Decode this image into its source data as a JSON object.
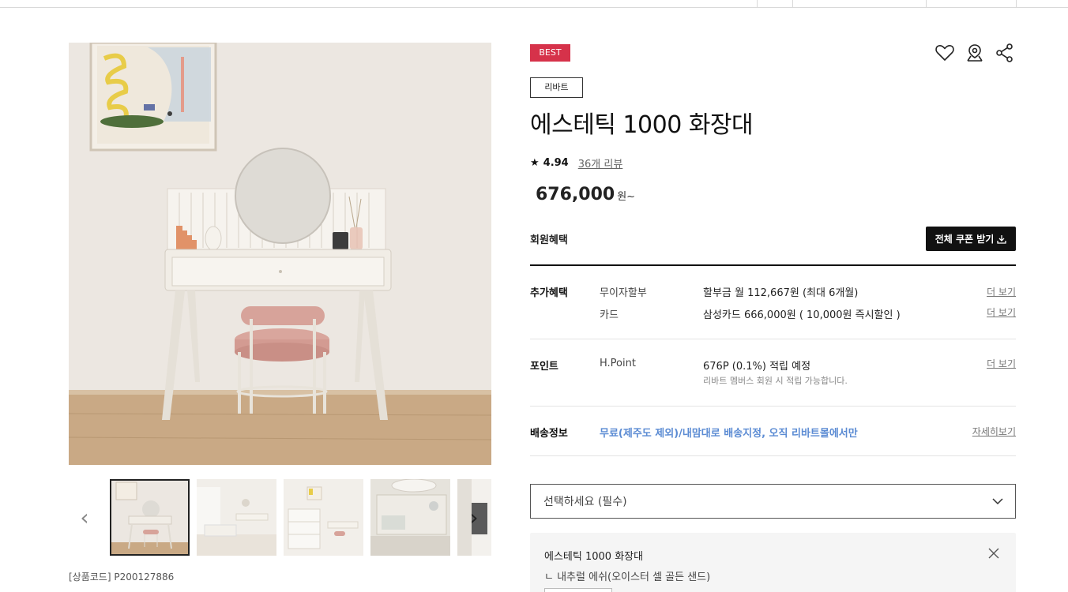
{
  "product": {
    "badge": "BEST",
    "brand": "리바트",
    "title": "에스테틱 1000 화장대",
    "rating": "4.94",
    "reviews": "36개 리뷰",
    "price": "676,000",
    "price_unit": "원~",
    "code": "[상품코드] P200127886"
  },
  "benefits": {
    "member_label": "회원혜택",
    "coupon_button": "전체 쿠폰 받기",
    "extra_label": "추가혜택",
    "installment_sub": "무이자할부",
    "installment_val": "할부금 월 112,667원 (최대 6개월)",
    "card_sub": "카드",
    "card_val": "삼성카드 666,000원 ( 10,000원 즉시할인 )",
    "more": "더 보기",
    "point_label": "포인트",
    "point_sub": "H.Point",
    "point_val": "676P (0.1%) 적립 예정",
    "point_note": "리바트 멤버스 회원 시 적립 가능합니다.",
    "shipping_label": "배송정보",
    "shipping_val": "무료(제주도 제외)/내맘대로 배송지정, 오직 리바트몰에서만",
    "shipping_more": "자세히보기"
  },
  "option": {
    "select_placeholder": "선택하세요 (필수)",
    "selected_title": "에스테틱 1000 화장대",
    "selected_sub": "ㄴ 내추럴 에쉬(오이스터 셀 골든 샌드)"
  },
  "icons": [
    "heart-icon",
    "map-pin-icon",
    "share-icon"
  ],
  "colors": {
    "badge": "#d6324a",
    "accent_link": "#5b8bd3",
    "button": "#111111"
  }
}
